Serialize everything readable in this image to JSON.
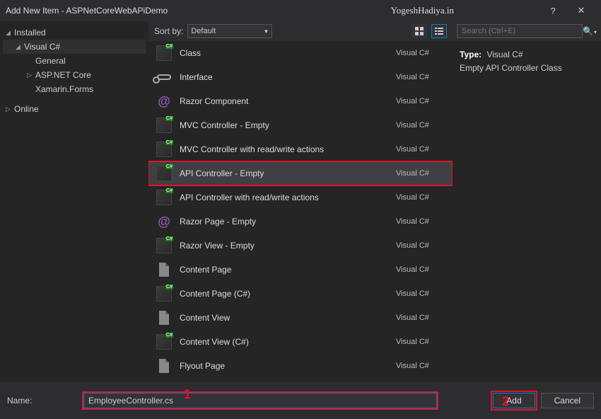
{
  "window": {
    "title": "Add New Item - ASPNetCoreWebAPiDemo",
    "brand": "YogeshHadiya.in",
    "help": "?",
    "close": "✕"
  },
  "tree": {
    "installed": "Installed",
    "visual_cs": "Visual C#",
    "general": "General",
    "aspnet": "ASP.NET Core",
    "xamarin": "Xamarin.Forms",
    "online": "Online"
  },
  "sort": {
    "label": "Sort by:",
    "value": "Default"
  },
  "templates": [
    {
      "label": "Class",
      "lang": "Visual C#",
      "icon": "cs"
    },
    {
      "label": "Interface",
      "lang": "Visual C#",
      "icon": "interface"
    },
    {
      "label": "Razor Component",
      "lang": "Visual C#",
      "icon": "razor"
    },
    {
      "label": "MVC Controller - Empty",
      "lang": "Visual C#",
      "icon": "cs"
    },
    {
      "label": "MVC Controller with read/write actions",
      "lang": "Visual C#",
      "icon": "cs"
    },
    {
      "label": "API Controller - Empty",
      "lang": "Visual C#",
      "icon": "cs",
      "selected": true,
      "highlight": true
    },
    {
      "label": "API Controller with read/write actions",
      "lang": "Visual C#",
      "icon": "cs"
    },
    {
      "label": "Razor Page - Empty",
      "lang": "Visual C#",
      "icon": "razor"
    },
    {
      "label": "Razor View - Empty",
      "lang": "Visual C#",
      "icon": "cs"
    },
    {
      "label": "Content Page",
      "lang": "Visual C#",
      "icon": "page"
    },
    {
      "label": "Content Page (C#)",
      "lang": "Visual C#",
      "icon": "cs"
    },
    {
      "label": "Content View",
      "lang": "Visual C#",
      "icon": "page"
    },
    {
      "label": "Content View (C#)",
      "lang": "Visual C#",
      "icon": "cs"
    },
    {
      "label": "Flyout Page",
      "lang": "Visual C#",
      "icon": "page"
    }
  ],
  "search": {
    "placeholder": "Search (Ctrl+E)"
  },
  "detail": {
    "type_label": "Type:",
    "type_value": "Visual C#",
    "description": "Empty API Controller Class"
  },
  "bottom": {
    "name_label": "Name:",
    "name_value": "EmployeeController.cs",
    "add": "Add",
    "cancel": "Cancel"
  },
  "markers": {
    "one": "1",
    "two": "2"
  }
}
